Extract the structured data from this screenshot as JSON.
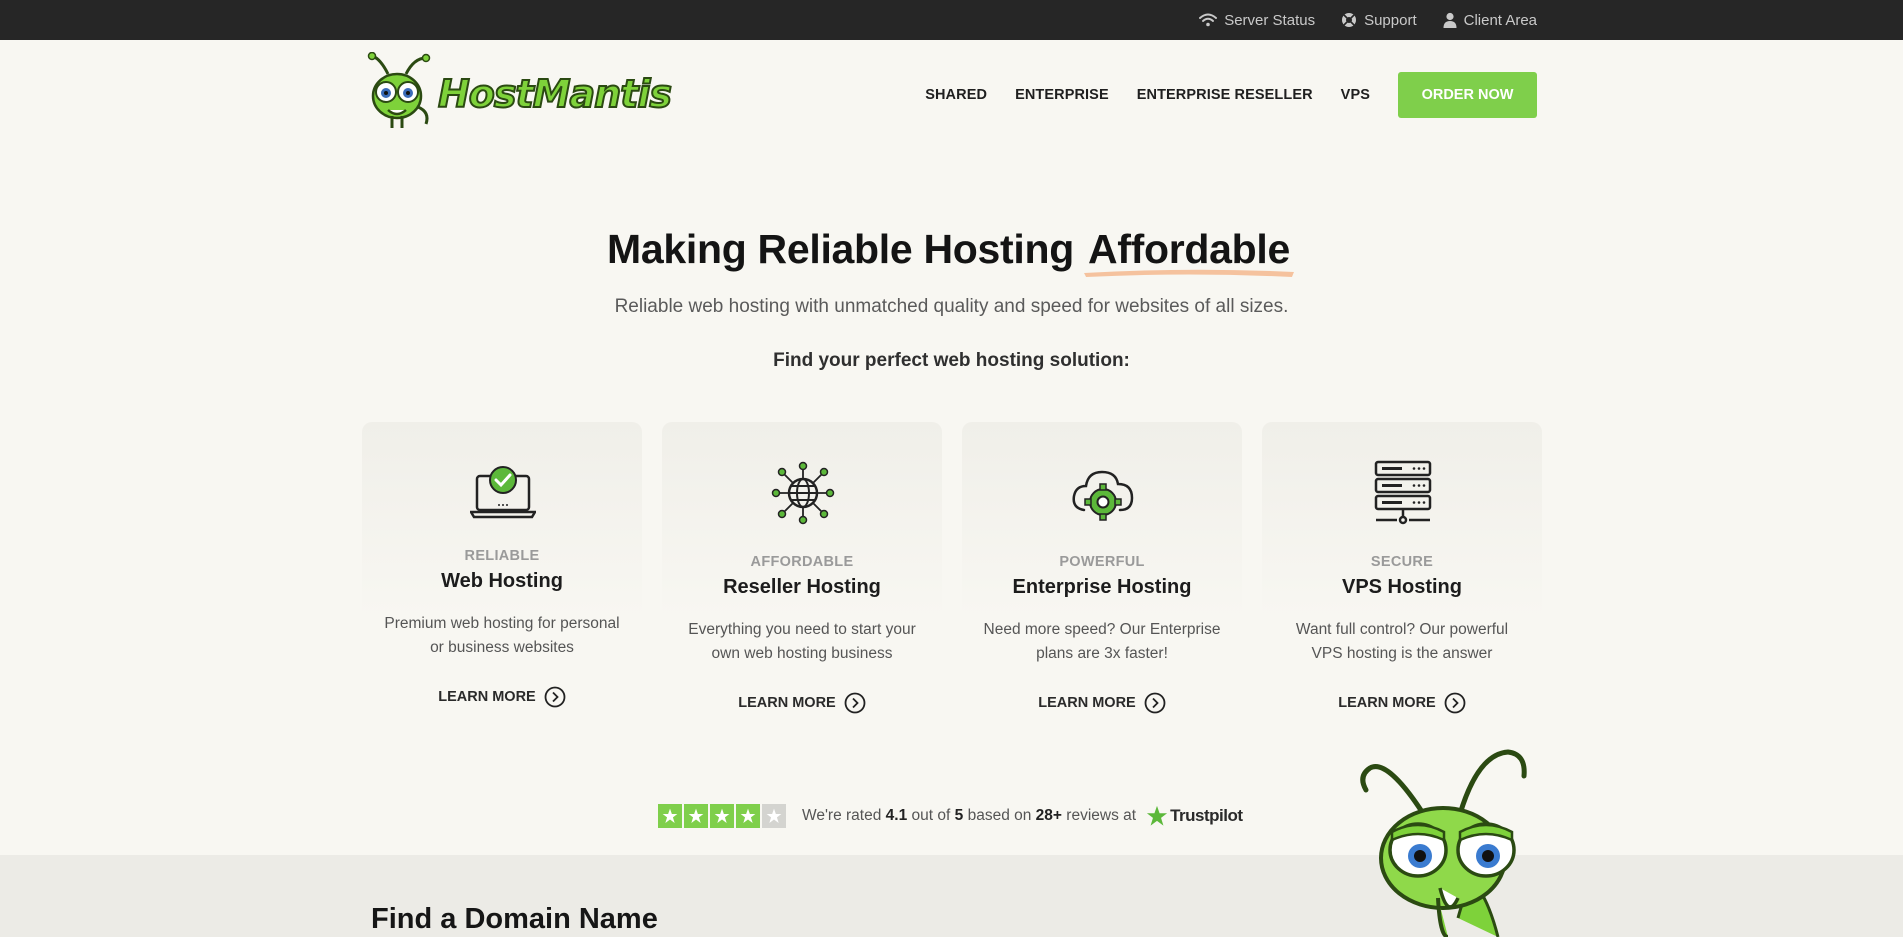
{
  "topbar": {
    "links": [
      {
        "label": "Server Status",
        "icon": "wifi-icon"
      },
      {
        "label": "Support",
        "icon": "lifebuoy-icon"
      },
      {
        "label": "Client Area",
        "icon": "user-icon"
      }
    ]
  },
  "brand": {
    "name": "HostMantis",
    "colors": {
      "primary_green": "#7fcf4b",
      "dark": "#262626",
      "highlight": "#f5b98f"
    }
  },
  "nav": {
    "items": [
      "SHARED",
      "ENTERPRISE",
      "ENTERPRISE RESELLER",
      "VPS"
    ],
    "cta": "ORDER NOW"
  },
  "hero": {
    "title_main": "Making Reliable Hosting",
    "title_highlight": "Affordable",
    "subtitle": "Reliable web hosting with unmatched quality and speed for websites of all sizes.",
    "find": "Find your perfect web hosting solution:"
  },
  "cards": [
    {
      "tag": "RELIABLE",
      "title": "Web Hosting",
      "desc1": "Premium web hosting for personal",
      "desc2": "or business websites",
      "link": "LEARN MORE",
      "icon": "laptop-check-icon"
    },
    {
      "tag": "AFFORDABLE",
      "title": "Reseller Hosting",
      "desc1": "Everything you need to start your",
      "desc2": "own web hosting business",
      "link": "LEARN MORE",
      "icon": "globe-network-icon"
    },
    {
      "tag": "POWERFUL",
      "title": "Enterprise Hosting",
      "desc1": "Need more speed? Our Enterprise",
      "desc2": "plans are 3x faster!",
      "link": "LEARN MORE",
      "icon": "cloud-gear-icon"
    },
    {
      "tag": "SECURE",
      "title": "VPS Hosting",
      "desc1": "Want full control? Our powerful",
      "desc2": "VPS hosting is the answer",
      "link": "LEARN MORE",
      "icon": "server-rack-icon"
    }
  ],
  "rating": {
    "prefix": "We're rated",
    "score": "4.1",
    "out_of": "out of",
    "max": "5",
    "based_on": "based on",
    "count": "28+",
    "reviews_at": "reviews at",
    "platform": "Trustpilot",
    "stars_filled": 4,
    "stars_total": 5
  },
  "domain": {
    "title": "Find a Domain Name"
  }
}
